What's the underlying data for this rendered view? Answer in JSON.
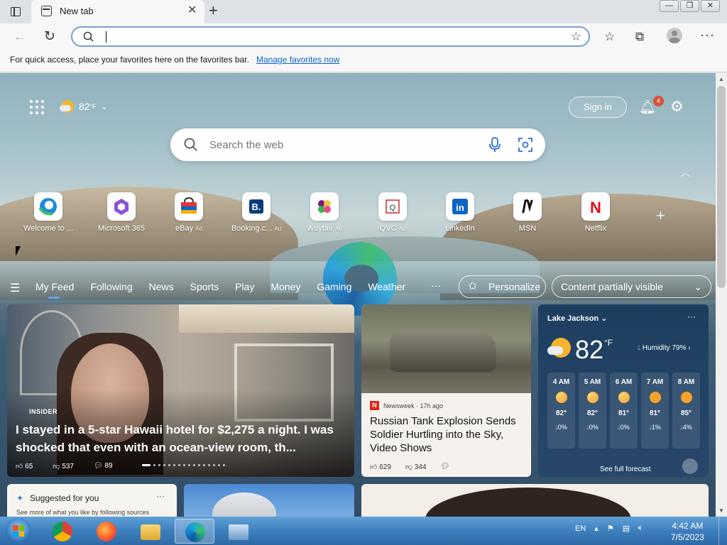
{
  "browser": {
    "tab_title": "New tab",
    "tab_close": "✕",
    "new_tab": "+",
    "window_buttons": [
      "—",
      "❐",
      "✕"
    ],
    "address_value": "",
    "back": "←",
    "refresh": "↻",
    "fav_star": "☆",
    "favorites": "☆",
    "collections": "⧉",
    "more": "···"
  },
  "favbar": {
    "message": "For quick access, place your favorites here on the favorites bar.",
    "link": "Manage favorites now"
  },
  "ntp": {
    "weather_temp": "82",
    "weather_unit": "°F",
    "sign_in": "Sign in",
    "notification_count": "4",
    "search_placeholder": "Search the web",
    "quick_links": [
      {
        "label": "Welcome to ...",
        "ad": "",
        "icon": "edge-icon"
      },
      {
        "label": "Microsoft 365",
        "ad": "",
        "icon": "m365-icon"
      },
      {
        "label": "eBay",
        "ad": "Ad",
        "icon": "ebay-icon"
      },
      {
        "label": "Booking.c...",
        "ad": "Ad",
        "icon": "booking-icon"
      },
      {
        "label": "Wayfair",
        "ad": "Ad",
        "icon": "wayfair-icon"
      },
      {
        "label": "QVC",
        "ad": "Ad",
        "icon": "qvc-icon"
      },
      {
        "label": "LinkedIn",
        "ad": "",
        "icon": "linkedin-icon"
      },
      {
        "label": "MSN",
        "ad": "",
        "icon": "msn-icon"
      },
      {
        "label": "Netflix",
        "ad": "",
        "icon": "netflix-icon"
      }
    ],
    "feed_tabs": [
      "My Feed",
      "Following",
      "News",
      "Sports",
      "Play",
      "Money",
      "Gaming",
      "Weather"
    ],
    "feed_more": "···",
    "personalize": "Personalize",
    "visibility": "Content partially visible"
  },
  "hero": {
    "source": "INSIDER",
    "headline": "I stayed in a 5-star Hawaii hotel for $2,275 a night. I was shocked that even with an ocean-view room, th...",
    "likes": "65",
    "dislikes": "537",
    "comments": "89"
  },
  "news": {
    "source": "Newsweek · 17h ago",
    "logo": "N",
    "headline": "Russian Tank Explosion Sends Soldier Hurtling into the Sky, Video Shows",
    "likes": "629",
    "dislikes": "344"
  },
  "weather": {
    "location": "Lake Jackson",
    "temp": "82",
    "unit": "°F",
    "humidity": "Humidity 79%",
    "hours": [
      {
        "time": "4 AM",
        "temp": "82°",
        "precip": "0%",
        "icon": "moon"
      },
      {
        "time": "5 AM",
        "temp": "82°",
        "precip": "0%",
        "icon": "moon"
      },
      {
        "time": "6 AM",
        "temp": "81°",
        "precip": "0%",
        "icon": "moon"
      },
      {
        "time": "7 AM",
        "temp": "81°",
        "precip": "1%",
        "icon": "sun"
      },
      {
        "time": "8 AM",
        "temp": "85°",
        "precip": "4%",
        "icon": "sun"
      }
    ],
    "forecast_link": "See full forecast"
  },
  "suggest": {
    "title": "Suggested for you",
    "sub": "See more of what you like by following sources"
  },
  "taskbar": {
    "lang": "EN",
    "time": "4:42 AM",
    "date": "7/5/2023"
  }
}
